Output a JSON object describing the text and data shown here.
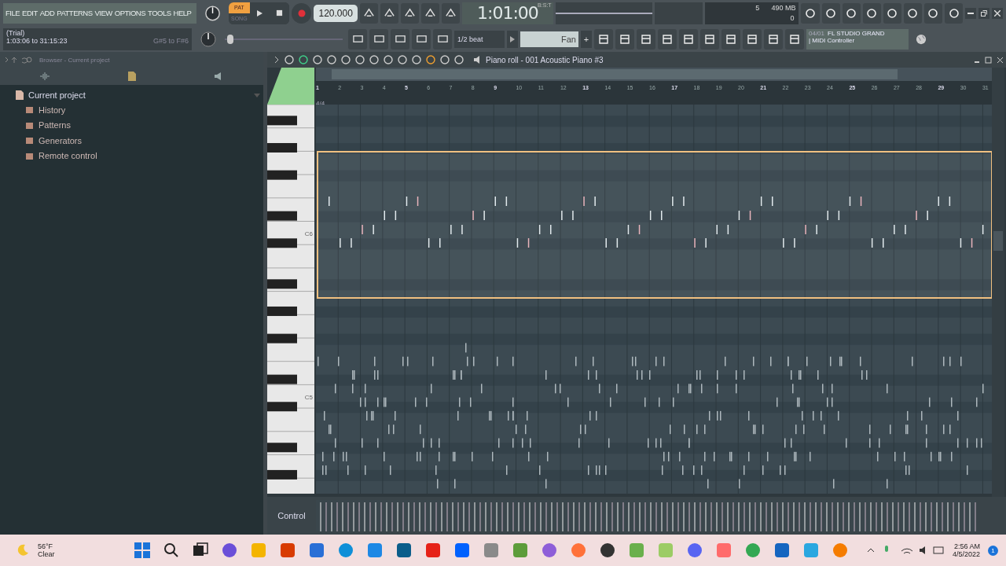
{
  "menu": [
    "FILE",
    "EDIT",
    "ADD",
    "PATTERNS",
    "VIEW",
    "OPTIONS",
    "TOOLS",
    "HELP"
  ],
  "hint": {
    "status": "(Trial)",
    "range": "1:03:06 to 31:15:23",
    "notes": "G#5 to F#6"
  },
  "transport": {
    "modes": [
      {
        "label": "PAT",
        "selected": true
      },
      {
        "label": "SONG",
        "selected": false
      }
    ],
    "tempo": "120.000"
  },
  "clock": {
    "time": "1:01:00",
    "unit": "B:S:T"
  },
  "monitor": {
    "voices": "5",
    "ram": "490 MB",
    "cpu": "0"
  },
  "master_volume": {
    "level": 0.02
  },
  "snap": "1/2 beat",
  "pattern": {
    "name": "Fan",
    "add": "+"
  },
  "hint_panel": {
    "count": "04/01",
    "title": "FL STUDIO GRAND",
    "subtitle": "| MIDI Controller"
  },
  "browser": {
    "title": "Browser - Current project",
    "tree": [
      {
        "label": "Current project",
        "expanded": true,
        "children": [
          {
            "label": "History"
          },
          {
            "label": "Patterns"
          },
          {
            "label": "Generators"
          },
          {
            "label": "Remote control"
          }
        ]
      }
    ]
  },
  "piano_roll": {
    "title": "Piano roll - 001 Acoustic Piano #3",
    "bars": [
      "1",
      "2",
      "3",
      "4",
      "5",
      "6",
      "7",
      "8",
      "9",
      "10",
      "11",
      "12",
      "13",
      "14",
      "15",
      "16",
      "17",
      "18",
      "19",
      "20",
      "21",
      "22",
      "23",
      "24",
      "25",
      "26",
      "27",
      "28",
      "29",
      "30",
      "31"
    ],
    "time_signature": "4/4",
    "key_labels": [
      "C6",
      "C5"
    ],
    "control_label": "Control"
  },
  "taskbar": {
    "temperature": "56°F",
    "condition": "Clear",
    "time": "2:56 AM",
    "date": "4/5/2022",
    "notifications": "1"
  }
}
